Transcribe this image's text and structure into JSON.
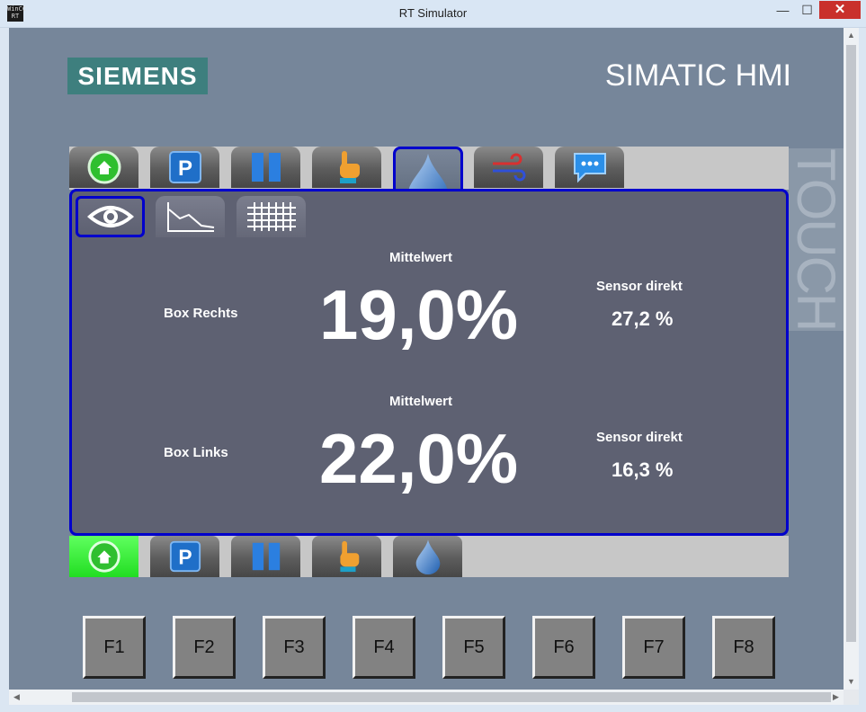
{
  "window": {
    "title": "RT Simulator",
    "app_icon_text": "WinCC RT",
    "close_glyph": "✕",
    "min_glyph": "—",
    "max_glyph": "☐"
  },
  "brand": {
    "logo": "SIEMENS",
    "product": "SIMATIC HMI",
    "side_label": "TOUCH"
  },
  "top_nav": [
    {
      "name": "home",
      "icon": "home-icon"
    },
    {
      "name": "parameter",
      "icon": "parking-p-icon",
      "glyph": "P"
    },
    {
      "name": "pause",
      "icon": "pause-icon"
    },
    {
      "name": "manual",
      "icon": "hand-pointer-icon"
    },
    {
      "name": "humidity",
      "icon": "water-drop-icon",
      "active": true
    },
    {
      "name": "airflow",
      "icon": "airflow-icon"
    },
    {
      "name": "messages",
      "icon": "chat-bubble-icon"
    }
  ],
  "sub_tabs": [
    {
      "name": "overview",
      "icon": "eye-icon",
      "active": true
    },
    {
      "name": "trend",
      "icon": "trend-chart-icon"
    },
    {
      "name": "table",
      "icon": "grid-icon"
    }
  ],
  "readings": {
    "right": {
      "label": "Box Rechts",
      "avg_label": "Mittelwert",
      "avg_value": "19,0%",
      "sensor_label": "Sensor direkt",
      "sensor_value": "27,2 %"
    },
    "left": {
      "label": "Box Links",
      "avg_label": "Mittelwert",
      "avg_value": "22,0%",
      "sensor_label": "Sensor direkt",
      "sensor_value": "16,3 %"
    }
  },
  "bottom_nav": [
    {
      "name": "home",
      "icon": "home-icon",
      "active": true
    },
    {
      "name": "parameter",
      "icon": "parking-p-icon",
      "glyph": "P"
    },
    {
      "name": "pause",
      "icon": "pause-icon"
    },
    {
      "name": "manual",
      "icon": "hand-pointer-icon"
    },
    {
      "name": "humidity",
      "icon": "water-drop-icon"
    }
  ],
  "function_keys": [
    "F1",
    "F2",
    "F3",
    "F4",
    "F5",
    "F6",
    "F7",
    "F8"
  ],
  "colors": {
    "accent_border": "#0000cc",
    "active_green": "#22dd22",
    "panel_bg": "#76869a",
    "content_bg": "#5e6172",
    "brand_teal": "#3e7f7e"
  }
}
